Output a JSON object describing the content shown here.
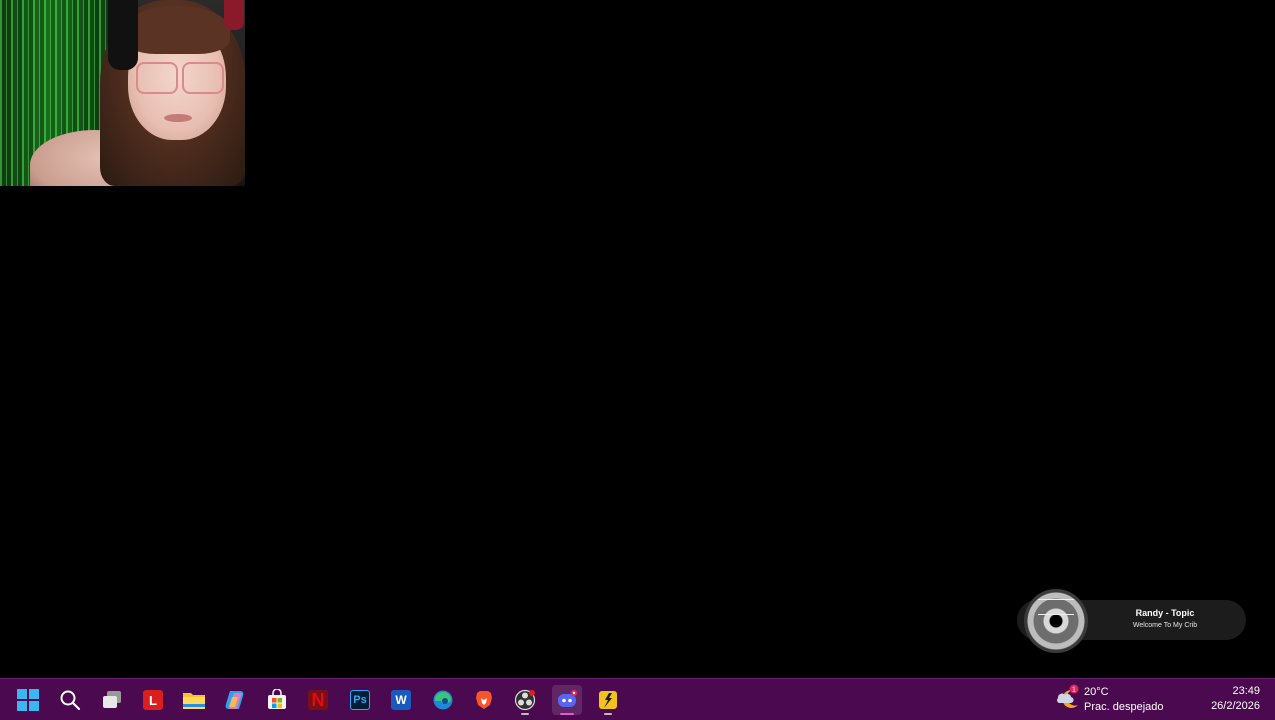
{
  "media": {
    "title": "Randy - Topic",
    "subtitle": "Welcome To My Crib"
  },
  "taskbar": {
    "background": "#4b0a4f",
    "apps": [
      {
        "name": "start-button",
        "icon": "windows-logo-icon"
      },
      {
        "name": "search-button",
        "icon": "search-icon"
      },
      {
        "name": "task-view-button",
        "icon": "task-view-icon"
      },
      {
        "name": "app-l",
        "icon": "l-app-icon",
        "label": "L"
      },
      {
        "name": "file-explorer",
        "icon": "folder-icon"
      },
      {
        "name": "copilot",
        "icon": "copilot-icon"
      },
      {
        "name": "microsoft-store",
        "icon": "store-icon"
      },
      {
        "name": "netflix",
        "icon": "netflix-icon",
        "label": "N"
      },
      {
        "name": "photoshop",
        "icon": "photoshop-icon",
        "label": "Ps"
      },
      {
        "name": "word",
        "icon": "word-icon",
        "label": "W"
      },
      {
        "name": "edge",
        "icon": "edge-icon"
      },
      {
        "name": "brave",
        "icon": "brave-icon"
      },
      {
        "name": "obs-studio",
        "icon": "obs-icon"
      },
      {
        "name": "discord",
        "icon": "discord-icon"
      },
      {
        "name": "app-runner",
        "icon": "runner-icon"
      }
    ]
  },
  "weather": {
    "temperature": "20°C",
    "description": "Prac. despejado",
    "badge": "1",
    "icon": "partly-cloudy-night-icon"
  },
  "clock": {
    "time": "23:49",
    "date": "26/2/2026"
  }
}
